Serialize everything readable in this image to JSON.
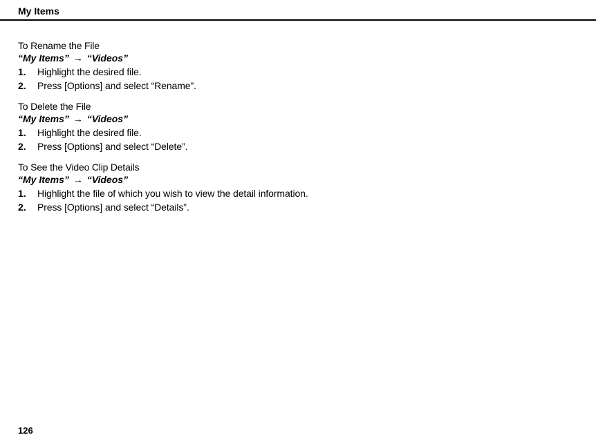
{
  "header": {
    "title": "My Items"
  },
  "sections": [
    {
      "title": "To Rename the File",
      "navPath": {
        "part1": "“My Items”",
        "arrow": "→",
        "part2": "“Videos”"
      },
      "steps": [
        {
          "num": "1.",
          "text": "Highlight the desired file."
        },
        {
          "num": "2.",
          "text": "Press [Options] and select “Rename”."
        }
      ]
    },
    {
      "title": "To Delete the File",
      "navPath": {
        "part1": "“My Items”",
        "arrow": "→",
        "part2": "“Videos”"
      },
      "steps": [
        {
          "num": "1.",
          "text": "Highlight the desired file."
        },
        {
          "num": "2.",
          "text": "Press [Options] and select “Delete”."
        }
      ]
    },
    {
      "title": "To See the Video Clip Details",
      "navPath": {
        "part1": "“My Items”",
        "arrow": "→",
        "part2": "“Videos”"
      },
      "steps": [
        {
          "num": "1.",
          "text": "Highlight the file of which you wish to view the detail information."
        },
        {
          "num": "2.",
          "text": "Press [Options] and select “Details”."
        }
      ]
    }
  ],
  "pageNumber": "126"
}
